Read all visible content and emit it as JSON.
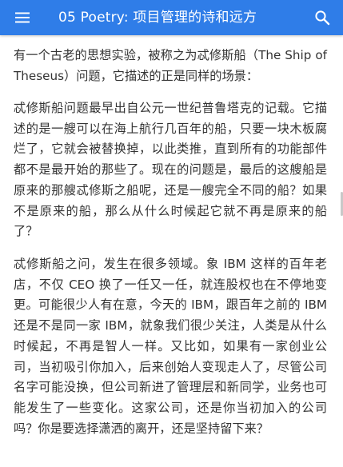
{
  "appbar": {
    "title": "05 Poetry: 项目管理的诗和远方",
    "menu_icon": "menu-icon",
    "search_icon": "search-icon",
    "color": "#2f7de8"
  },
  "content": {
    "paragraphs": [
      "有一个古老的思想实验，被称之为忒修斯船（The Ship of Theseus）问题，它描述的正是同样的场景：",
      "忒修斯船问题最早出自公元一世纪普鲁塔克的记载。它描述的是一艘可以在海上航行几百年的船，只要一块木板腐烂了，它就会被替换掉，以此类推，直到所有的功能部件都不是最开始的那些了。现在的问题是，最后的这艘船是原来的那艘忒修斯之船呢，还是一艘完全不同的船？如果不是原来的船，那么从什么时候起它就不再是原来的船了？",
      "忒修斯船之问，发生在很多领域。象 IBM 这样的百年老店，不仅 CEO 换了一任又一任，就连股权也在不停地变更。可能很少人有在意，今天的 IBM，跟百年之前的 IBM 还是不是同一家 IBM，就象我们很少关注，人类是从什么时候起，不再是智人一样。又比如，如果有一家创业公司，当初吸引你加入，后来创始人变现走人了，尽管公司名字可能没换，但公司新进了管理层和新同学，业务也可能发生了一些变化。这家公司，还是你当初加入的公司吗？你是要选择潇洒的离开，还是坚持留下来？"
    ]
  }
}
